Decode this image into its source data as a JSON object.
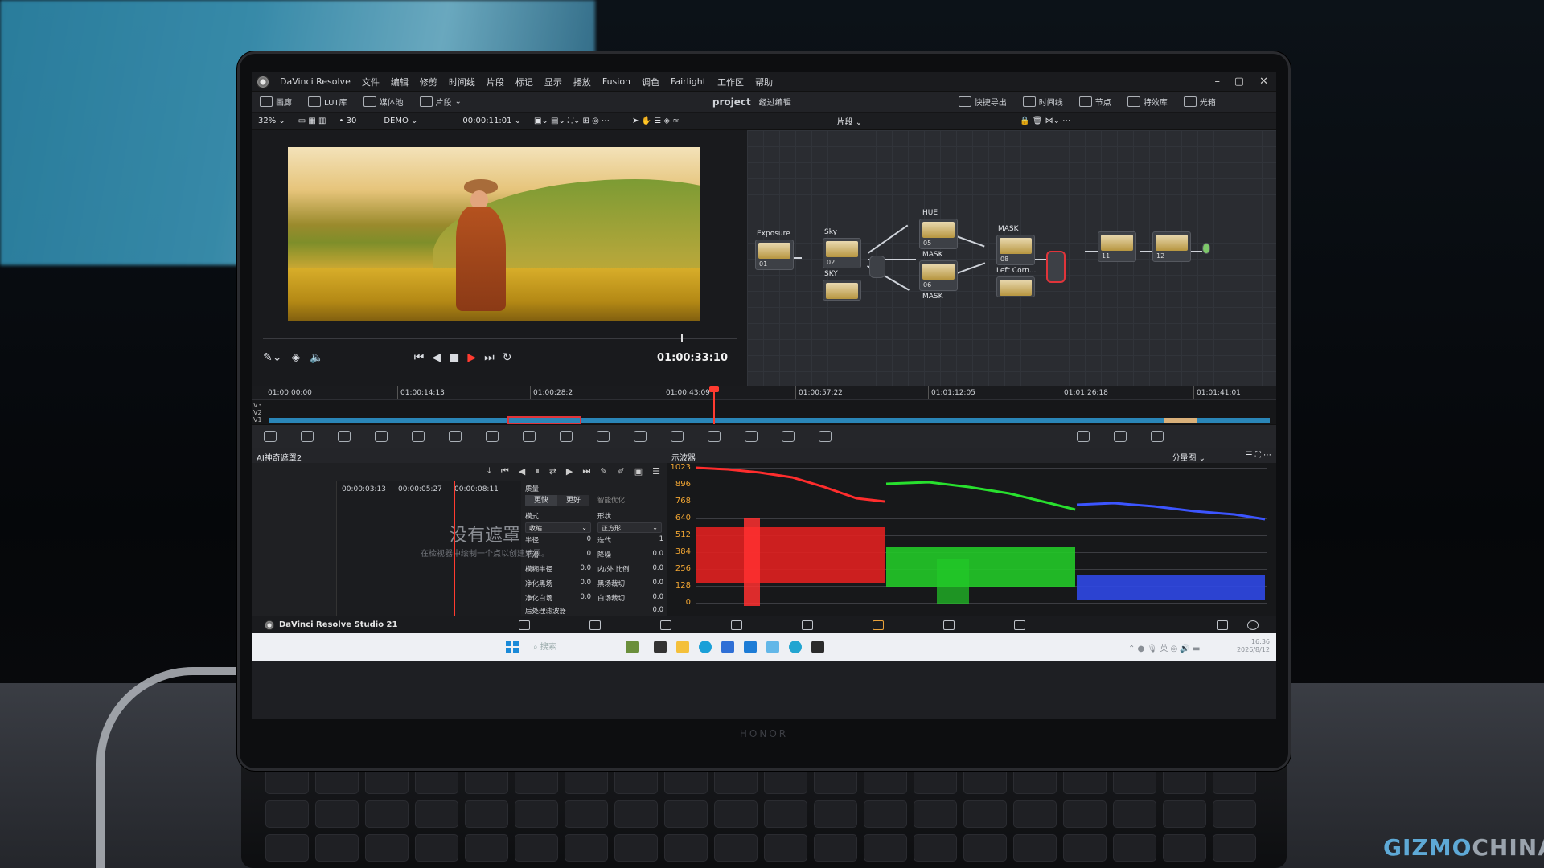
{
  "app": {
    "name": "DaVinci Resolve",
    "menus": [
      "文件",
      "编辑",
      "修剪",
      "时间线",
      "片段",
      "标记",
      "显示",
      "播放",
      "Fusion",
      "调色",
      "Fairlight",
      "工作区",
      "帮助"
    ],
    "footer_name": "DaVinci Resolve Studio 21"
  },
  "toolbar": {
    "gallery": "画廊",
    "lut": "LUT库",
    "media": "媒体池",
    "clips": "片段",
    "project": "project",
    "edited": "经过编辑",
    "quick_export": "快捷导出",
    "timeline": "时间线",
    "nodes": "节点",
    "effects": "特效库",
    "lightbox": "光箱"
  },
  "toolbar2": {
    "zoom": "32%",
    "fps": "30",
    "timeline_name": "DEMO",
    "timecode": "00:00:11:01",
    "node_mode": "片段"
  },
  "viewer": {
    "timecode": "01:00:33:10"
  },
  "nodes": {
    "labels": {
      "exposure": "Exposure",
      "sky": "Sky",
      "sky2": "SKY",
      "hue": "HUE",
      "mask1": "MASK",
      "mask2": "MASK",
      "mask3": "MASK",
      "leftcorn": "Left Corn..."
    },
    "numbers": [
      "01",
      "02",
      "05",
      "06",
      "08",
      "11",
      "12"
    ]
  },
  "ruler": [
    "01:00:00:00",
    "01:00:14:13",
    "01:00:28:2",
    "01:00:43:09",
    "01:00:57:22",
    "01:01:12:05",
    "01:01:26:18",
    "01:01:41:01"
  ],
  "tracks": [
    "V3",
    "V2",
    "V1"
  ],
  "mask_panel": {
    "title": "AI神奇遮罩2",
    "tcs": [
      "00:00:03:13",
      "00:00:05:27",
      "00:00:08:11"
    ],
    "empty_title": "没有遮罩",
    "empty_sub": "在检视器中绘制一个点以创建遮罩。",
    "quality_label": "质量",
    "faster": "更快",
    "better": "更好",
    "smart": "智能优化",
    "mode_label": "模式",
    "mode_value": "收缩",
    "shape_label": "形状",
    "shape_value": "正方形",
    "radius": "半径",
    "radius_v": "0",
    "iter": "迭代",
    "iter_v": "1",
    "smooth": "平滑",
    "smooth_v": "0",
    "denoise": "降噪",
    "denoise_v": "0.0",
    "blur_radius": "模糊半径",
    "blur_radius_v": "0.0",
    "inout": "内/外 比例",
    "inout_v": "0.0",
    "clean_black": "净化黑场",
    "clean_black_v": "0.0",
    "black_clip": "黑场裁切",
    "black_clip_v": "0.0",
    "clean_white": "净化白场",
    "clean_white_v": "0.0",
    "white_clip": "白场裁切",
    "white_clip_v": "0.0",
    "post_filter": "后处理滤波器",
    "post_filter_v": "0.0"
  },
  "scope": {
    "title": "示波器",
    "mode": "分量图",
    "y_labels": [
      "1023",
      "896",
      "768",
      "640",
      "512",
      "384",
      "256",
      "128",
      "0"
    ]
  },
  "taskbar": {
    "search": "搜索",
    "lang": "英",
    "time": "16:36",
    "date": "2026/8/12"
  },
  "watermark": {
    "a": "GIZMO",
    "b": "CHINA"
  },
  "brand": "HONOR",
  "colors": {
    "accent_red": "#ff3b30",
    "timeline_blue": "#2a86b8",
    "scope_label": "#f0a533"
  }
}
